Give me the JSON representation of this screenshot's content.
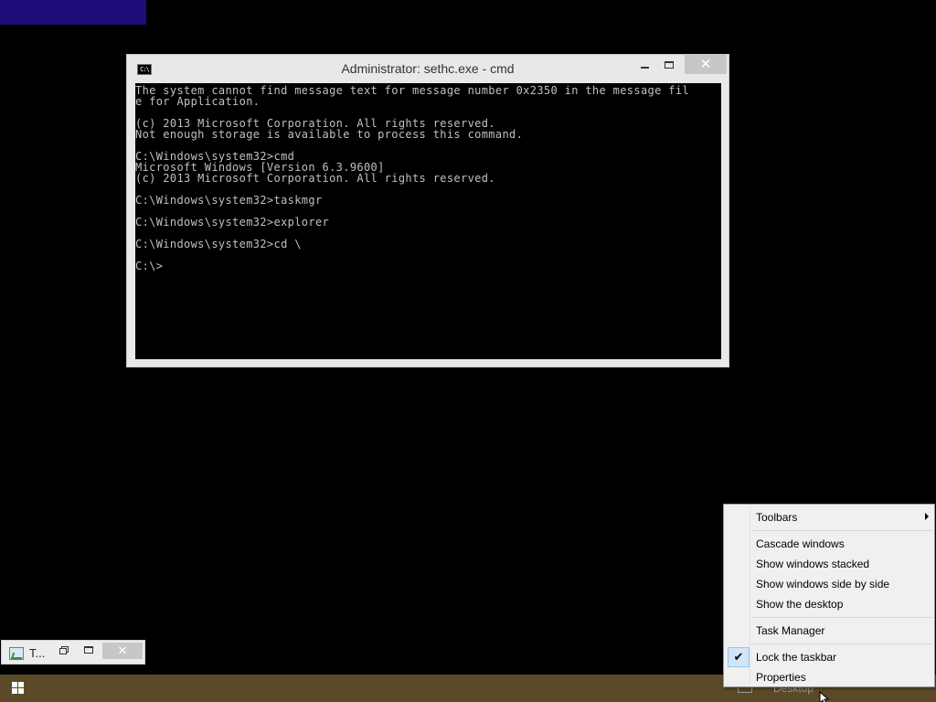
{
  "window": {
    "title": "Administrator: sethc.exe - cmd",
    "icon_text": "C:\\",
    "close_glyph": "✕",
    "console_lines": [
      "The system cannot find message text for message number 0x2350 in the message fil",
      "e for Application.",
      "",
      "(c) 2013 Microsoft Corporation. All rights reserved.",
      "Not enough storage is available to process this command.",
      "",
      "C:\\Windows\\system32>cmd",
      "Microsoft Windows [Version 6.3.9600]",
      "(c) 2013 Microsoft Corporation. All rights reserved.",
      "",
      "C:\\Windows\\system32>taskmgr",
      "",
      "C:\\Windows\\system32>explorer",
      "",
      "C:\\Windows\\system32>cd \\",
      "",
      "C:\\>"
    ]
  },
  "mini_window": {
    "label": "T...",
    "close_glyph": "✕"
  },
  "taskbar": {
    "desktop_label": "Desktop"
  },
  "context_menu": {
    "items": [
      {
        "label": "Toolbars",
        "submenu": true
      },
      {
        "label": "Cascade windows"
      },
      {
        "label": "Show windows stacked"
      },
      {
        "label": "Show windows side by side"
      },
      {
        "label": "Show the desktop"
      },
      {
        "label": "Task Manager"
      },
      {
        "label": "Lock the taskbar",
        "checked": true
      },
      {
        "label": "Properties"
      }
    ],
    "check_glyph": "✔"
  },
  "colors": {
    "desktop": "#000000",
    "taskbar": "#5a4a28",
    "console_text": "#c0c0c0",
    "accent_purple": "#1e0c78"
  },
  "icons": [
    "cmd-window-icon",
    "minimize-icon",
    "maximize-icon",
    "close-icon",
    "task-manager-icon",
    "restore-icon",
    "windows-logo-icon",
    "tray-icon",
    "submenu-arrow-icon",
    "checkmark-icon",
    "mouse-cursor-icon"
  ]
}
